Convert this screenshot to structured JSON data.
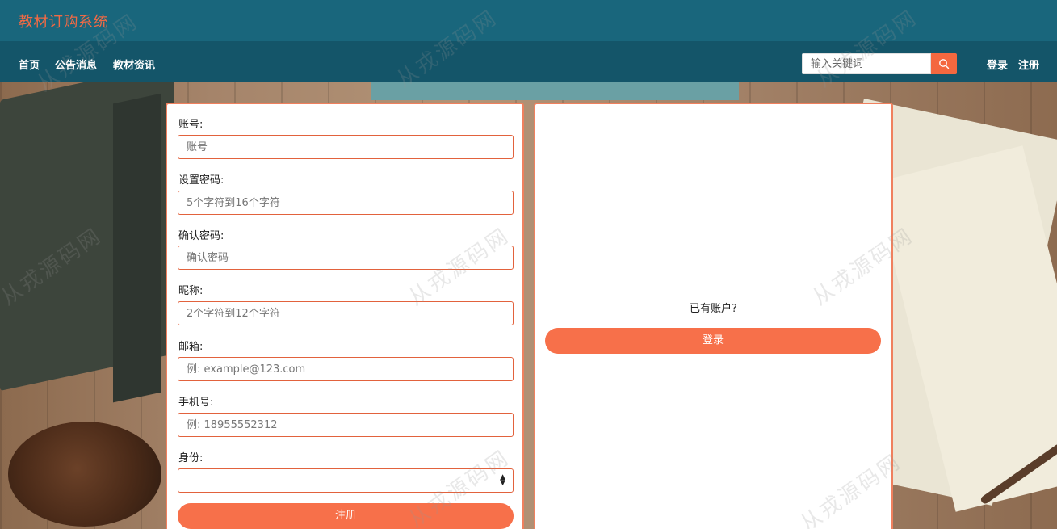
{
  "header": {
    "brand": "教材订购系统"
  },
  "nav": {
    "items": [
      "首页",
      "公告消息",
      "教材资讯"
    ],
    "search": {
      "placeholder": "输入关键词"
    },
    "auth": {
      "login": "登录",
      "register": "注册"
    }
  },
  "register_form": {
    "fields": [
      {
        "label": "账号:",
        "placeholder": "账号"
      },
      {
        "label": "设置密码:",
        "placeholder": "5个字符到16个字符"
      },
      {
        "label": "确认密码:",
        "placeholder": "确认密码"
      },
      {
        "label": "昵称:",
        "placeholder": "2个字符到12个字符"
      },
      {
        "label": "邮箱:",
        "placeholder": "例: example@123.com"
      },
      {
        "label": "手机号:",
        "placeholder": "例: 18955552312"
      }
    ],
    "role": {
      "label": "身份:",
      "value": ""
    },
    "submit_label": "注册"
  },
  "login_panel": {
    "prompt": "已有账户?",
    "login_label": "登录"
  },
  "watermark": "从戎源码网",
  "colors": {
    "header_bg": "#19667c",
    "nav_bg": "#145569",
    "accent": "#f7704a",
    "brand_text": "#f06a45"
  }
}
